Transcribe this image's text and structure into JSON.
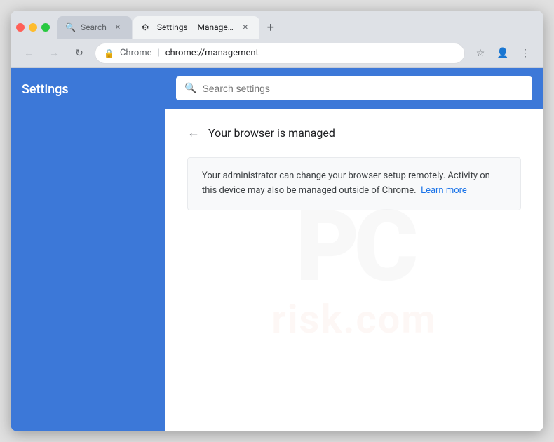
{
  "window": {
    "controls": {
      "close_label": "",
      "min_label": "",
      "max_label": ""
    },
    "tabs": [
      {
        "id": "tab-search",
        "label": "Search",
        "favicon": "🔍",
        "active": false
      },
      {
        "id": "tab-management",
        "label": "Settings – Management",
        "favicon": "⚙",
        "active": true
      }
    ],
    "new_tab_label": "+"
  },
  "address_bar": {
    "back_title": "Back",
    "forward_title": "Forward",
    "reload_title": "Reload",
    "lock_icon": "🔒",
    "url_origin": "Chrome",
    "url_separator": "|",
    "url_path": "chrome://management",
    "bookmark_icon": "☆",
    "account_icon": "👤",
    "menu_icon": "⋮"
  },
  "sidebar": {
    "title": "Settings"
  },
  "search": {
    "placeholder": "Search settings"
  },
  "content": {
    "back_arrow": "←",
    "page_title": "Your browser is managed",
    "info_text": "Your administrator can change your browser setup remotely. Activity on this device may also be managed outside of Chrome.",
    "learn_more_label": "Learn more"
  },
  "watermark": {
    "pc": "PC",
    "risk": "risk.com"
  }
}
